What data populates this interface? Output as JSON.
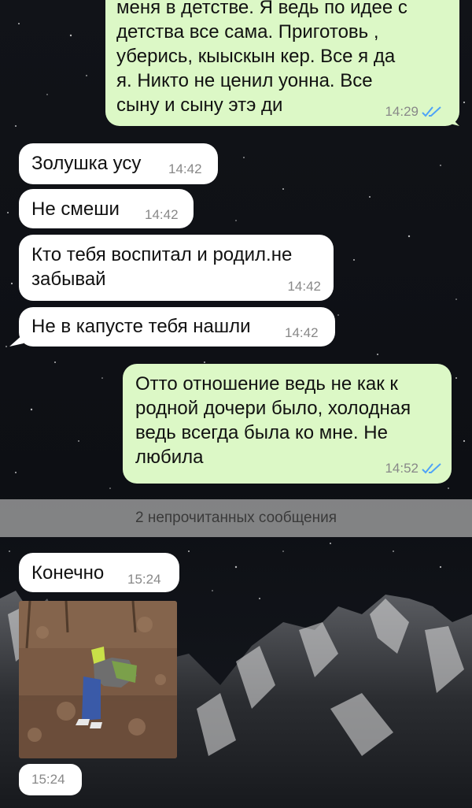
{
  "messages": [
    {
      "id": "m0",
      "direction": "outgoing",
      "text": "меня в детстве. Я ведь по идее с детства все сама. Приготовь , уберись, кыыскын кер. Все я да я. Никто не ценил уонна. Все сыну и сыну этэ ди",
      "time": "14:29",
      "status": "read"
    },
    {
      "id": "m1",
      "direction": "incoming",
      "text": "Золушка усу",
      "time": "14:42"
    },
    {
      "id": "m2",
      "direction": "incoming",
      "text": "Не смеши",
      "time": "14:42"
    },
    {
      "id": "m3",
      "direction": "incoming",
      "text": "Кто тебя воспитал и родил.не забывай",
      "time": "14:42"
    },
    {
      "id": "m4",
      "direction": "incoming",
      "text": "Не в капусте тебя нашли",
      "time": "14:42"
    },
    {
      "id": "m5",
      "direction": "outgoing",
      "text": "Отто отношение ведь не как к родной дочери было, холодная ведь всегда была ко мне. Не любила",
      "time": "14:52",
      "status": "read"
    },
    {
      "id": "m6",
      "direction": "incoming",
      "text": "Конечно",
      "time": "15:24"
    },
    {
      "id": "m7",
      "direction": "incoming",
      "type": "photo",
      "time": "15:24"
    }
  ],
  "unread_divider": "2 непрочитанных сообщения",
  "colors": {
    "incoming": "#ffffff",
    "outgoing": "#dcf8c6",
    "read_ticks": "#4fa3f7",
    "time": "#888888",
    "divider": "#aaaaaa"
  }
}
